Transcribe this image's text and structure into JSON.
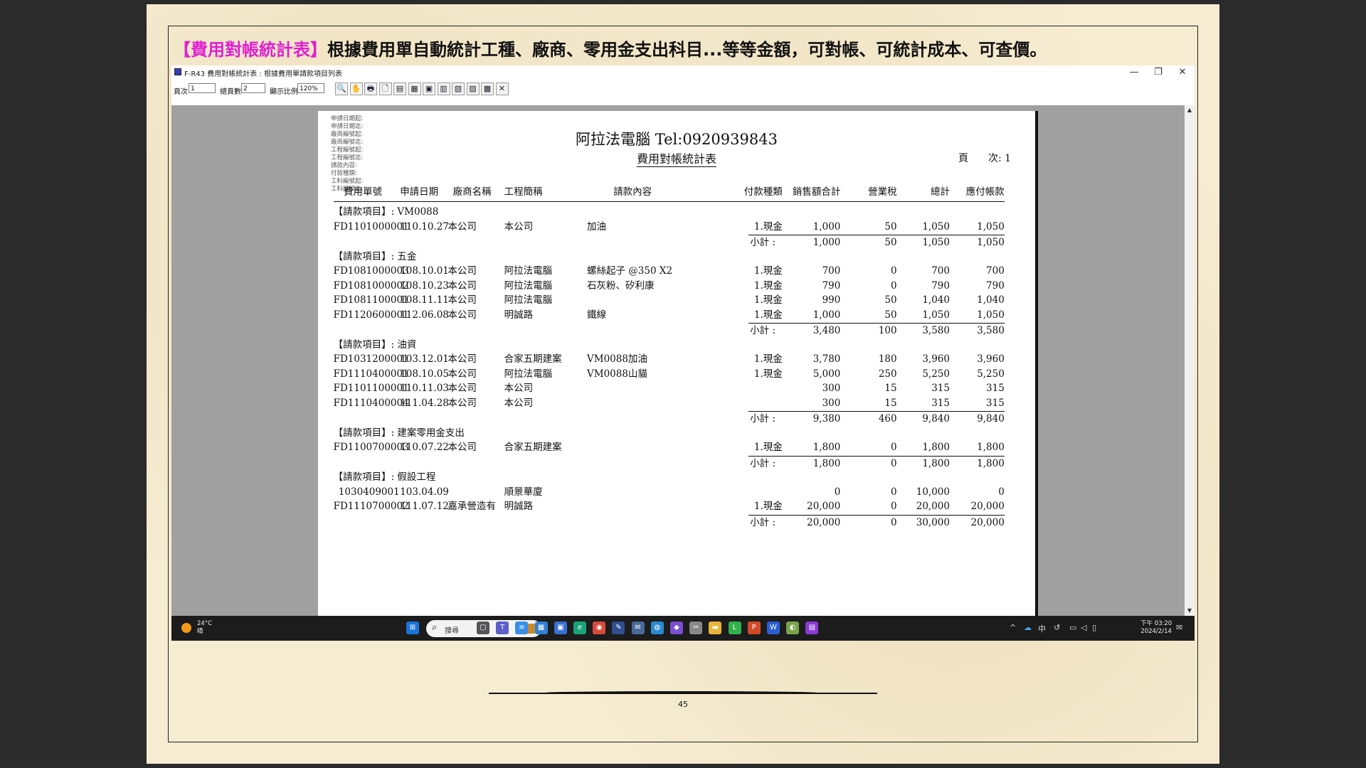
{
  "slide": {
    "headline_highlight": "【費用對帳統計表】",
    "headline_rest": "根據費用單自動統計工種、廠商、零用金支出科目...等等金額，可對帳、可統計成本、可查價。",
    "page_number": "45"
  },
  "window": {
    "title": "F-R43 費用對帳統計表 : 根據費用單請款項目列表",
    "minimize": "—",
    "restore": "❐",
    "close": "✕"
  },
  "toolbar": {
    "page_label": "頁次",
    "page_value": "1",
    "total_label": "總頁數",
    "total_value": "2",
    "zoom_label": "顯示比例",
    "zoom_value": "120%",
    "buttons": [
      "🔍",
      "✋",
      "🖶",
      "🗋",
      "▤",
      "▦",
      "▣",
      "▥",
      "▧",
      "▨",
      "▩",
      "✕"
    ]
  },
  "report": {
    "filters": [
      "申請日期起:",
      "申請日期迄:",
      "廠商編號起:",
      "廠商編號迄:",
      "工程編號起:",
      "工程編號迄:",
      "請款內容:",
      "付款種類:",
      "工料編號起:",
      "工料編號迄:"
    ],
    "company": "阿拉法電腦 Tel:0920939843",
    "title": "費用對帳統計表",
    "page_text": "頁　　次:   1",
    "columns": [
      "費用單號",
      "申請日期",
      "廠商名稱",
      "工程簡稱",
      "請款內容",
      "付款種類",
      "銷售額合計",
      "營業稅",
      "總計",
      "應付帳款"
    ],
    "subtotal_label": "小計 :",
    "groups": [
      {
        "label": "【請款項目】: VM0088",
        "rows": [
          [
            "FD1101000001",
            "110.10.27",
            "本公司",
            "本公司",
            "加油",
            "1.現金",
            "1,000",
            "50",
            "1,050",
            "1,050"
          ]
        ],
        "subtotal": [
          "1,000",
          "50",
          "1,050",
          "1,050"
        ]
      },
      {
        "label": "【請款項目】: 五金",
        "rows": [
          [
            "FD1081000003",
            "108.10.01",
            "本公司",
            "阿拉法電腦",
            "螺絲起子 @350 X2",
            "1.現金",
            "700",
            "0",
            "700",
            "700"
          ],
          [
            "FD1081000002",
            "108.10.23",
            "本公司",
            "阿拉法電腦",
            "石灰粉、矽利康",
            "1.現金",
            "790",
            "0",
            "790",
            "790"
          ],
          [
            "FD1081100001",
            "108.11.11",
            "本公司",
            "阿拉法電腦",
            "",
            "1.現金",
            "990",
            "50",
            "1,040",
            "1,040"
          ],
          [
            "FD1120600001",
            "112.06.08",
            "本公司",
            "明誠路",
            "鐵線",
            "1.現金",
            "1,000",
            "50",
            "1,050",
            "1,050"
          ]
        ],
        "subtotal": [
          "3,480",
          "100",
          "3,580",
          "3,580"
        ]
      },
      {
        "label": "【請款項目】: 油資",
        "rows": [
          [
            "FD1031200001",
            "103.12.01",
            "本公司",
            "合家五期建案",
            "VM0088加油",
            "1.現金",
            "3,780",
            "180",
            "3,960",
            "3,960"
          ],
          [
            "FD1110400001",
            "108.10.05",
            "本公司",
            "阿拉法電腦",
            "VM0088山貓",
            "1.現金",
            "5,000",
            "250",
            "5,250",
            "5,250"
          ],
          [
            "FD1101100001",
            "110.11.03",
            "本公司",
            "本公司",
            "",
            "",
            "300",
            "15",
            "315",
            "315"
          ],
          [
            "FD1110400004",
            "111.04.28",
            "本公司",
            "本公司",
            "",
            "",
            "300",
            "15",
            "315",
            "315"
          ]
        ],
        "subtotal": [
          "9,380",
          "460",
          "9,840",
          "9,840"
        ]
      },
      {
        "label": "【請款項目】: 建案零用金支出",
        "rows": [
          [
            "FD1100700003",
            "110.07.22",
            "本公司",
            "合家五期建案",
            "",
            "1.現金",
            "1,800",
            "0",
            "1,800",
            "1,800"
          ]
        ],
        "subtotal": [
          "1,800",
          "0",
          "1,800",
          "1,800"
        ]
      },
      {
        "label": "【請款項目】: 假設工程",
        "rows": [
          [
            "1030409001",
            "103.04.09",
            "",
            "順景華廈",
            "",
            "",
            "0",
            "0",
            "10,000",
            "0"
          ],
          [
            "FD1110700002",
            "111.07.12",
            "嘉承營造有",
            "明誠路",
            "",
            "1.現金",
            "20,000",
            "0",
            "20,000",
            "20,000"
          ]
        ],
        "subtotal": [
          "20,000",
          "0",
          "30,000",
          "20,000"
        ]
      }
    ]
  },
  "taskbar": {
    "temp": "24°C",
    "weather": "晴",
    "search_glyph": "⌕",
    "search_placeholder": "搜尋",
    "ime": "中",
    "time": "下午 03:20",
    "date": "2024/2/14"
  }
}
